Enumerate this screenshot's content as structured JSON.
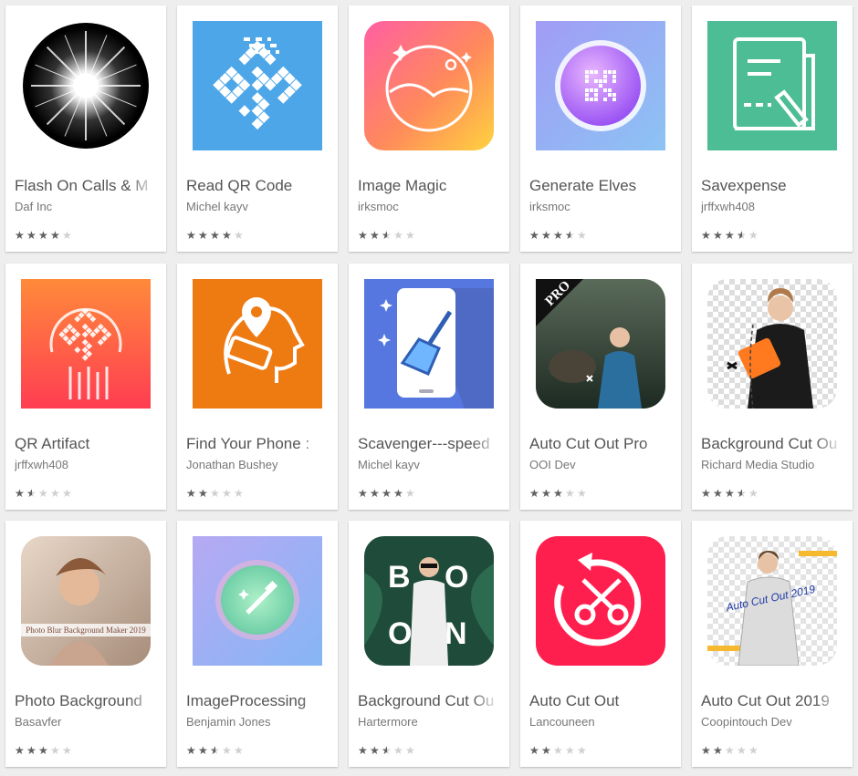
{
  "colors": {
    "star_filled": "#616161",
    "star_empty": "#d0d0d0",
    "card_bg": "#ffffff",
    "page_bg": "#eeeeee"
  },
  "apps": [
    {
      "title": "Flash On Calls & M",
      "developer": "Daf Inc",
      "rating": 4,
      "icon": "flash-burst-icon"
    },
    {
      "title": "Read QR Code",
      "developer": "Michel kayv",
      "rating": 4,
      "icon": "qr-code-icon"
    },
    {
      "title": "Image Magic",
      "developer": "irksmoc",
      "rating": 2.5,
      "icon": "landscape-circle-icon"
    },
    {
      "title": "Generate Elves",
      "developer": "irksmoc",
      "rating": 3.5,
      "icon": "qr-orb-icon"
    },
    {
      "title": "Savexpense",
      "developer": "jrffxwh408",
      "rating": 3.5,
      "icon": "note-pen-icon"
    },
    {
      "title": "QR Artifact",
      "developer": "jrffxwh408",
      "rating": 1.5,
      "icon": "qr-scan-icon"
    },
    {
      "title": "Find Your Phone :",
      "developer": "Jonathan Bushey",
      "rating": 2,
      "icon": "head-location-icon"
    },
    {
      "title": "Scavenger---speed",
      "developer": "Michel kayv",
      "rating": 4,
      "icon": "phone-broom-icon"
    },
    {
      "title": "Auto Cut Out Pro",
      "developer": "OOI Dev",
      "rating": 3,
      "icon": "pro-photo-cut-icon"
    },
    {
      "title": "Background Cut Ou",
      "developer": "Richard Media Studio",
      "rating": 3.5,
      "icon": "woman-cutout-icon"
    },
    {
      "title": "Photo Background",
      "developer": "Basavfer",
      "rating": 3,
      "icon": "photo-blur-portrait-icon"
    },
    {
      "title": "ImageProcessing",
      "developer": "Benjamin Jones",
      "rating": 2.5,
      "icon": "magic-wand-blob-icon"
    },
    {
      "title": "Background Cut Ou",
      "developer": "Hartermore",
      "rating": 2.5,
      "icon": "boom-photo-icon"
    },
    {
      "title": "Auto Cut Out",
      "developer": "Lancouneen",
      "rating": 2,
      "icon": "scissors-circle-icon"
    },
    {
      "title": "Auto Cut Out 2019",
      "developer": "Coopintouch Dev",
      "rating": 2,
      "icon": "cutout-2019-icon"
    }
  ],
  "icon_texts": {
    "pro_badge": "PRO",
    "photo_blur": "Photo Blur Background Maker 2019",
    "boom": [
      "B",
      "O",
      "O",
      "N"
    ],
    "cutout_2019": "Auto Cut Out 2019"
  }
}
